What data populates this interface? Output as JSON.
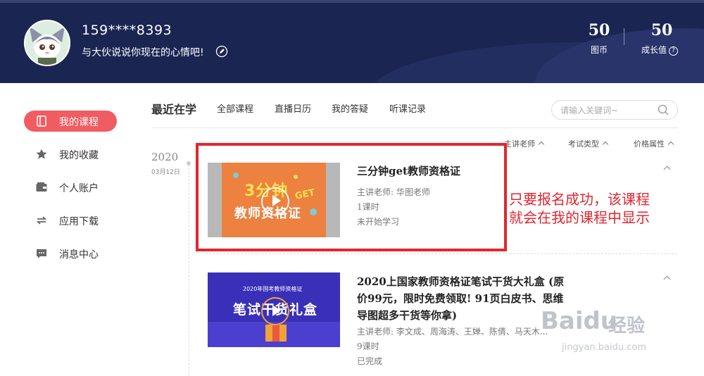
{
  "header": {
    "username": "159****8393",
    "mood": "与大伙说说你现在的心情吧!",
    "stats": [
      {
        "value": "50",
        "label": "图币"
      },
      {
        "value": "50",
        "label": "成长值"
      }
    ]
  },
  "sidebar": {
    "items": [
      {
        "label": "我的课程",
        "icon": "book-icon",
        "active": true
      },
      {
        "label": "我的收藏",
        "icon": "star-icon"
      },
      {
        "label": "个人账户",
        "icon": "wallet-icon"
      },
      {
        "label": "应用下载",
        "icon": "sync-icon"
      },
      {
        "label": "消息中心",
        "icon": "message-icon"
      }
    ]
  },
  "tabs": {
    "main": "最近在学",
    "items": [
      "全部课程",
      "直播日历",
      "我的答疑",
      "听课记录"
    ]
  },
  "search": {
    "placeholder": "请输入关键词~"
  },
  "filters": [
    "主讲老师",
    "考试类型",
    "价格属性"
  ],
  "timeline": {
    "year": "2020",
    "date": "03月12日"
  },
  "courses": [
    {
      "title": "三分钟get教师资格证",
      "teacher": "主讲老师: 华图老师",
      "lessons": "1课时",
      "status": "未开始学习",
      "thumb_text_1": "3分钟",
      "thumb_text_2": "GET",
      "thumb_text_3": "教师资格证"
    },
    {
      "title_lines": [
        "2020上国家教师资格证笔试干货大礼盒 (原",
        "价99元，限时免费领取! 91页白皮书、思维",
        "导图超多干货等你拿)"
      ],
      "teacher": "主讲老师: 李文成、周海涛、王婵、陈倩、马天木...",
      "lessons": "9课时",
      "status": "已完成",
      "thumb_text_1": "2020年国考教师资格证",
      "thumb_text_2": "笔试干货礼盒"
    }
  ],
  "annotation": {
    "lines": [
      "只要报名成功，该课程",
      "就会在我的课程中显示"
    ]
  },
  "watermark": {
    "brand": "Baidu",
    "brand_cn": "经验",
    "url": "jingyan.baidu.com"
  },
  "colors": {
    "header_bg": "#1b2552",
    "accent": "#ef5d63",
    "annotation": "#e2262f"
  }
}
